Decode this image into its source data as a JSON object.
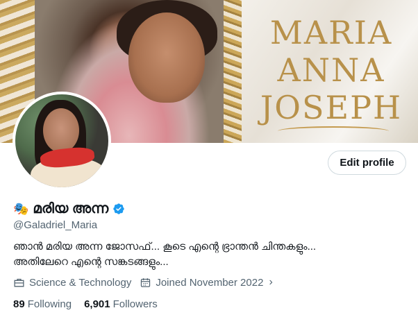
{
  "banner": {
    "title_lines": [
      "MARIA",
      "ANNA",
      "JOSEPH"
    ]
  },
  "profile": {
    "edit_button_label": "Edit profile",
    "name_emoji": "🎭",
    "display_name": "മരിയ അന്ന",
    "handle": "@Galadriel_Maria",
    "bio_lines": [
      "ഞാൻ മരിയ അന്ന ജോസഫ്... കൂടെ എന്റെ ഭ്രാന്തൻ ചിന്തകളും...",
      "അതിലേറെ എന്റെ സങ്കടങ്ങളും..."
    ],
    "category": "Science & Technology",
    "category_icon": "briefcase-icon",
    "joined": "Joined November 2022",
    "joined_icon": "calendar-icon",
    "following_count": "89",
    "following_label": "Following",
    "followers_count": "6,901",
    "followers_label": "Followers"
  },
  "colors": {
    "verified_blue": "#1d9bf0",
    "secondary_text": "#536471",
    "title_gold": "#b8914a"
  }
}
